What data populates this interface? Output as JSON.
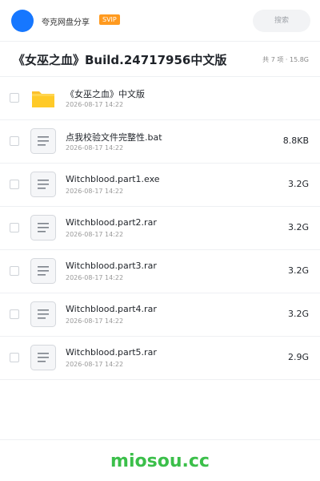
{
  "header": {
    "site_name": "夸克网盘分享",
    "badge": "SVIP",
    "search_placeholder": "搜索"
  },
  "share": {
    "title": "《女巫之血》Build.24717956中文版",
    "summary": "共 7 项 · 15.8G"
  },
  "files": [
    {
      "name": "《女巫之血》中文版",
      "date": "2026-08-17 14:22",
      "size": "",
      "icon": "folder-icon"
    },
    {
      "name": "点我校验文件完整性.bat",
      "date": "2026-08-17 14:22",
      "size": "8.8KB",
      "icon": "file-icon"
    },
    {
      "name": "Witchblood.part1.exe",
      "date": "2026-08-17 14:22",
      "size": "3.2G",
      "icon": "file-icon"
    },
    {
      "name": "Witchblood.part2.rar",
      "date": "2026-08-17 14:22",
      "size": "3.2G",
      "icon": "file-icon"
    },
    {
      "name": "Witchblood.part3.rar",
      "date": "2026-08-17 14:22",
      "size": "3.2G",
      "icon": "file-icon"
    },
    {
      "name": "Witchblood.part4.rar",
      "date": "2026-08-17 14:22",
      "size": "3.2G",
      "icon": "file-icon"
    },
    {
      "name": "Witchblood.part5.rar",
      "date": "2026-08-17 14:22",
      "size": "2.9G",
      "icon": "file-icon"
    }
  ],
  "footer": {
    "brand": "miosou.cc"
  },
  "colors": {
    "accent": "#1677ff",
    "badge": "#ff9a1f",
    "brand": "#3bbf4a",
    "folder": "#fbc02d"
  }
}
